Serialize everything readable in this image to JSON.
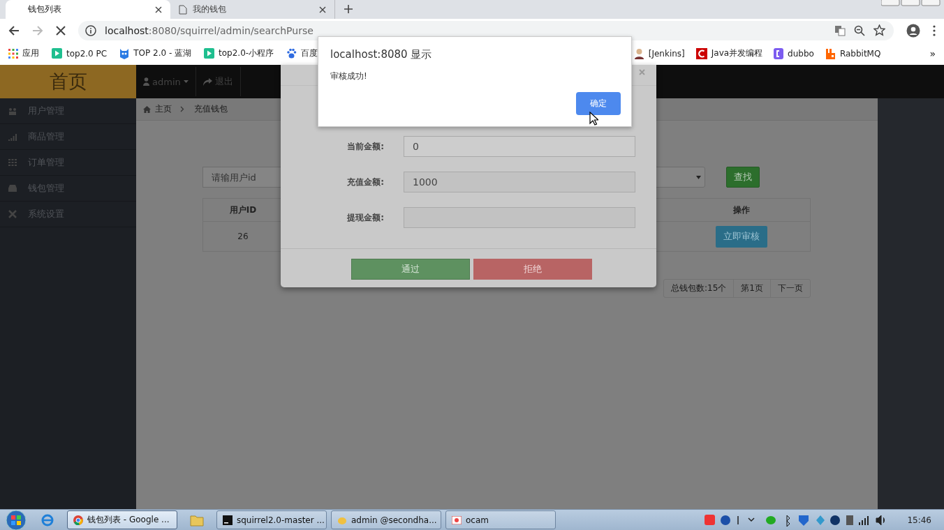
{
  "browser": {
    "tabs": [
      {
        "title": "钱包列表",
        "selected": true
      },
      {
        "title": "我的钱包",
        "selected": false
      }
    ],
    "address_host": "localhost",
    "address_path": ":8080/squirrel/admin/searchPurse",
    "bookmarks": [
      {
        "label": "应用",
        "kind": "apps"
      },
      {
        "label": "top2.0 PC",
        "kind": "play"
      },
      {
        "label": "TOP 2.0 - 蓝湖",
        "kind": "bird"
      },
      {
        "label": "top2.0-小程序",
        "kind": "play"
      },
      {
        "label": "百度",
        "kind": "paw"
      }
    ],
    "bookmarks_right": [
      {
        "label": "[Jenkins]",
        "kind": "person"
      },
      {
        "label": "Java并发编程",
        "kind": "c"
      },
      {
        "label": "dubbo",
        "kind": "bracket"
      },
      {
        "label": "RabbitMQ",
        "kind": "rabbit"
      }
    ],
    "more": "»"
  },
  "header": {
    "brand": "首页",
    "user": "admin",
    "logout": "退出"
  },
  "sidebar": [
    {
      "label": "用户管理",
      "kind": "users"
    },
    {
      "label": "商品管理",
      "kind": "chart"
    },
    {
      "label": "订单管理",
      "kind": "grid"
    },
    {
      "label": "钱包管理",
      "kind": "inbox"
    },
    {
      "label": "系统设置",
      "kind": "settings"
    }
  ],
  "breadcrumb": [
    "主页",
    "充值钱包"
  ],
  "search": {
    "placeholder": "请输用户id",
    "button": "查找"
  },
  "table": {
    "columns": [
      "用户ID",
      "操作"
    ],
    "rows": [
      {
        "user_id": "26",
        "action": "立即审核"
      }
    ]
  },
  "pagination": [
    "总钱包数:15个",
    "第1页",
    "下一页"
  ],
  "modal": {
    "fields": [
      {
        "label": "当前金额:",
        "value": "0"
      },
      {
        "label": "充值金额:",
        "value": "1000"
      },
      {
        "label": "提现金额:"
      }
    ],
    "buttons": [
      {
        "label": "通过",
        "kind": "approve"
      },
      {
        "label": "拒绝",
        "kind": "reject"
      }
    ]
  },
  "alert": {
    "title": "localhost:8080 显示",
    "message": "审核成功!",
    "button": "确定"
  },
  "taskbar": {
    "tasks": [
      {
        "label": "钱包列表 - Google ...",
        "kind": "chrome",
        "selected": true
      },
      {
        "label": "squirrel2.0-master ...",
        "kind": "ij",
        "selected": false
      },
      {
        "label": "admin @secondha...",
        "kind": "db",
        "selected": false
      },
      {
        "label": "ocam",
        "kind": "ocam",
        "selected": false
      }
    ],
    "clock": "15:46"
  }
}
